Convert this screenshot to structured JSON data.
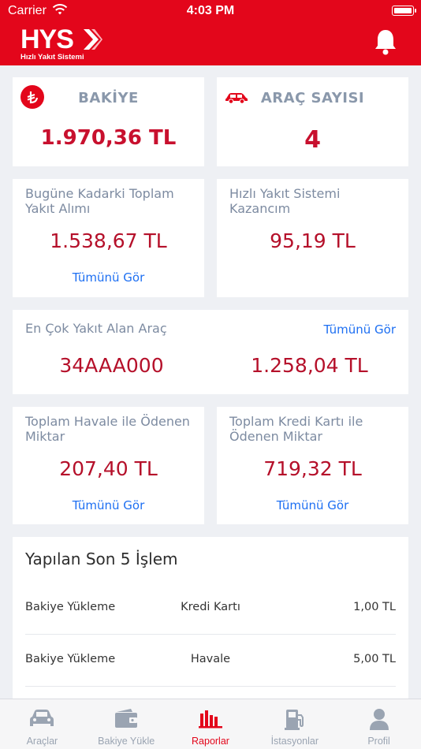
{
  "status_bar": {
    "carrier": "Carrier",
    "time": "4:03 PM"
  },
  "header": {
    "logo_word": "HYS",
    "logo_tagline": "Hızlı Yakıt Sistemi",
    "brand_color": "#e3061b"
  },
  "balance_card": {
    "title": "BAKİYE",
    "value": "1.970,36 TL",
    "icon": "lira-icon"
  },
  "vehicles_card": {
    "title": "ARAÇ SAYISI",
    "value": "4",
    "icon": "car-icon"
  },
  "total_fuel_card": {
    "label": "Bugüne Kadarki Toplam Yakıt Alımı",
    "value": "1.538,67 TL",
    "link": "Tümünü Gör"
  },
  "earnings_card": {
    "label": "Hızlı Yakıt Sistemi Kazancım",
    "value": "95,19 TL"
  },
  "top_vehicle_card": {
    "label": "En Çok Yakıt Alan Araç",
    "link": "Tümünü Gör",
    "plate": "34AAA000",
    "amount": "1.258,04 TL"
  },
  "wire_card": {
    "label": "Toplam Havale ile Ödenen Miktar",
    "value": "207,40 TL",
    "link": "Tümünü Gör"
  },
  "credit_card": {
    "label": "Toplam Kredi Kartı ile Ödenen Miktar",
    "value": "719,32 TL",
    "link": "Tümünü Gör"
  },
  "transactions": {
    "title": "Yapılan Son 5 İşlem",
    "rows": [
      {
        "type": "Bakiye Yükleme",
        "method": "Kredi Kartı",
        "amount": "1,00 TL"
      },
      {
        "type": "Bakiye Yükleme",
        "method": "Havale",
        "amount": "5,00 TL"
      }
    ]
  },
  "tabbar": {
    "active_color": "#e3061b",
    "tabs": [
      {
        "label": "Araçlar",
        "icon": "car-icon"
      },
      {
        "label": "Bakiye Yükle",
        "icon": "wallet-icon"
      },
      {
        "label": "Raporlar",
        "icon": "bar-chart-icon",
        "active": true
      },
      {
        "label": "İstasyonlar",
        "icon": "fuel-pump-icon"
      },
      {
        "label": "Profil",
        "icon": "user-icon"
      }
    ]
  }
}
